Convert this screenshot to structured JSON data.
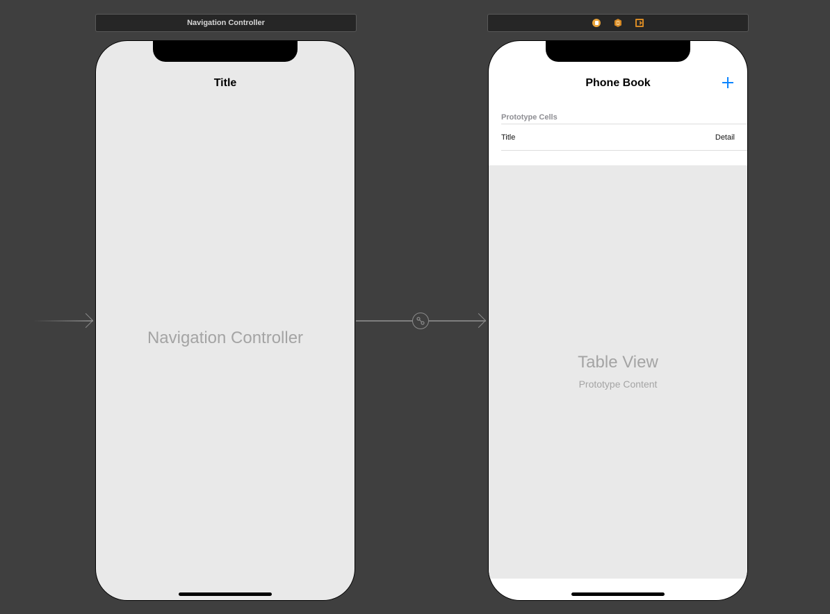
{
  "nav_scene": {
    "bar_title": "Navigation Controller",
    "nav_title": "Title",
    "placeholder": "Navigation Controller"
  },
  "table_scene": {
    "bar_icons": [
      "view-controller-icon",
      "first-responder-icon",
      "exit-icon"
    ],
    "nav_title": "Phone Book",
    "add_button": "+",
    "section_header": "Prototype Cells",
    "cell": {
      "title": "Title",
      "detail": "Detail"
    },
    "placeholder_title": "Table View",
    "placeholder_subtitle": "Prototype Content"
  },
  "colors": {
    "canvas": "#3f3f3f",
    "accent": "#0a84ff",
    "placeholder_text": "#a4a4a4"
  }
}
